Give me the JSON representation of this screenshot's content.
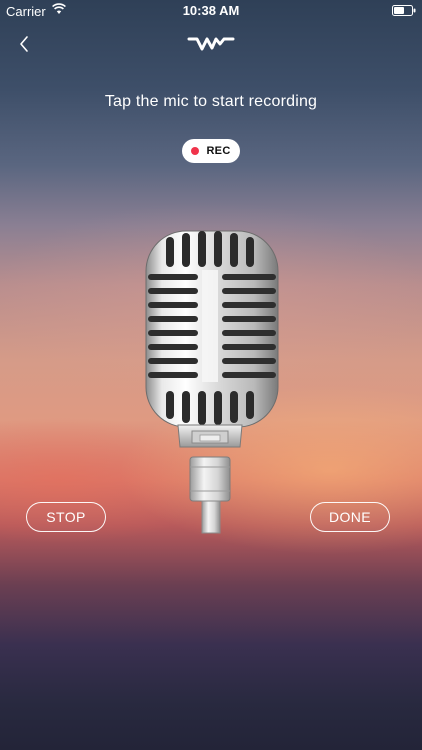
{
  "status_bar": {
    "carrier": "Carrier",
    "time": "10:38 AM",
    "wifi_icon": "wifi-icon",
    "battery_icon": "battery-icon"
  },
  "nav": {
    "back_icon": "chevron-left-icon",
    "logo_icon": "waveform-logo-icon"
  },
  "prompt": "Tap the mic to start recording",
  "rec_badge": {
    "label": "REC",
    "dot_color": "#f0334b"
  },
  "mic_icon": "microphone-icon",
  "buttons": {
    "stop": "STOP",
    "done": "DONE"
  }
}
